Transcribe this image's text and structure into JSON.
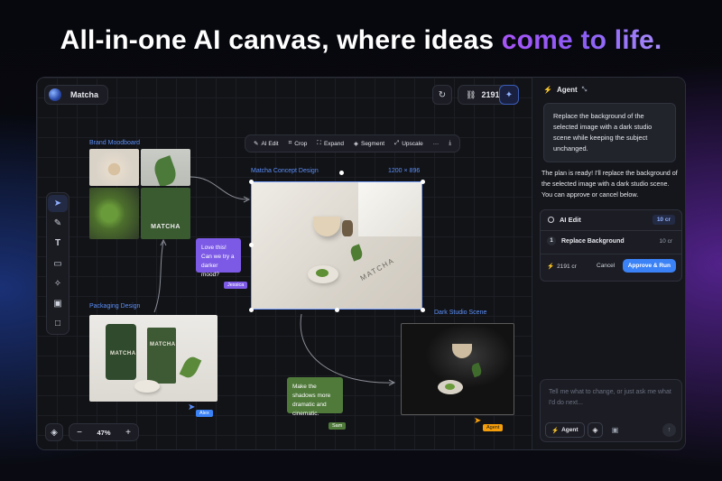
{
  "headline": {
    "prefix": "All-in-one AI canvas, where ideas ",
    "accent": "come to life."
  },
  "project": {
    "name": "Matcha"
  },
  "top": {
    "credits": "2191"
  },
  "toolbar": {
    "ai_edit": "AI Edit",
    "crop": "Crop",
    "expand": "Expand",
    "segment": "Segment",
    "upscale": "Upscale",
    "more": "···"
  },
  "labels": {
    "moodboard": "Brand Moodboard",
    "concept": "Matcha Concept Design",
    "dims": "1200 × 896",
    "packaging": "Packaging Design",
    "studio": "Dark Studio Scene"
  },
  "product_text": "MATCHA",
  "notes": {
    "jessica": {
      "text": "Love this! Can we try a darker mood?",
      "author": "Jessica"
    },
    "sam": {
      "text": "Make the shadows more dramatic and cinematic.",
      "author": "Sam"
    }
  },
  "cursors": {
    "alex": "Alex",
    "agent": "Agent"
  },
  "zoom": {
    "value": "47%",
    "minus": "−",
    "plus": "+"
  },
  "panel": {
    "title": "Agent",
    "user_message": "Replace the background of the selected image with a dark studio scene while keeping the subject unchanged.",
    "reply": "The plan is ready! I'll replace the background of the selected image with a dark studio scene. You can approve or cancel below.",
    "plan": {
      "title": "AI Edit",
      "cost": "10 cr",
      "steps": [
        {
          "num": "1",
          "label": "Replace Background",
          "cost": "10 cr"
        }
      ],
      "credits": "2191 cr",
      "cancel": "Cancel",
      "approve": "Approve & Run"
    },
    "input_placeholder": "Tell me what to change, or just ask me what I'd do next...",
    "agent_button": "Agent"
  },
  "colors": {
    "accent": "#5b8ff9",
    "purple": "#7c5ae6",
    "green": "#4f7a3a",
    "orange": "#f59e0b",
    "approve": "#3b82f6"
  }
}
